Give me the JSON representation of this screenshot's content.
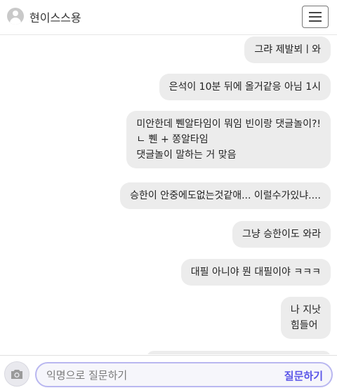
{
  "header": {
    "username": "현이스스용",
    "avatar_icon": "person-icon",
    "menu_icon": "hamburger-menu-icon"
  },
  "messages": [
    {
      "text": "그랴 제발뵈ㅣ와"
    },
    {
      "text": "은석이 10분 뒤에 올거같응 아님 1시"
    },
    {
      "text": "미안한데 쀈알타임이 뭐임 빈이랑 댓글놀이?!\nㄴ 쀈 + 쫑알타임\n댓글놀이 말하는 거 맞음"
    },
    {
      "text": "승한이 안중에도없는것같애... 이럴수가있냐...."
    },
    {
      "text": "그냥 승한이도 와라"
    },
    {
      "text": "대필 아니야 뭔 대필이야 ㅋㅋㅋ"
    },
    {
      "text": "나 지낫\n힘들어"
    },
    {
      "text": ""
    }
  ],
  "composer": {
    "camera_icon": "camera-icon",
    "placeholder": "익명으로 질문하기",
    "send_label": "질문하기"
  },
  "colors": {
    "bubble": "#ececec",
    "accent": "#5a55e8",
    "input_border": "#b9b7f0"
  }
}
